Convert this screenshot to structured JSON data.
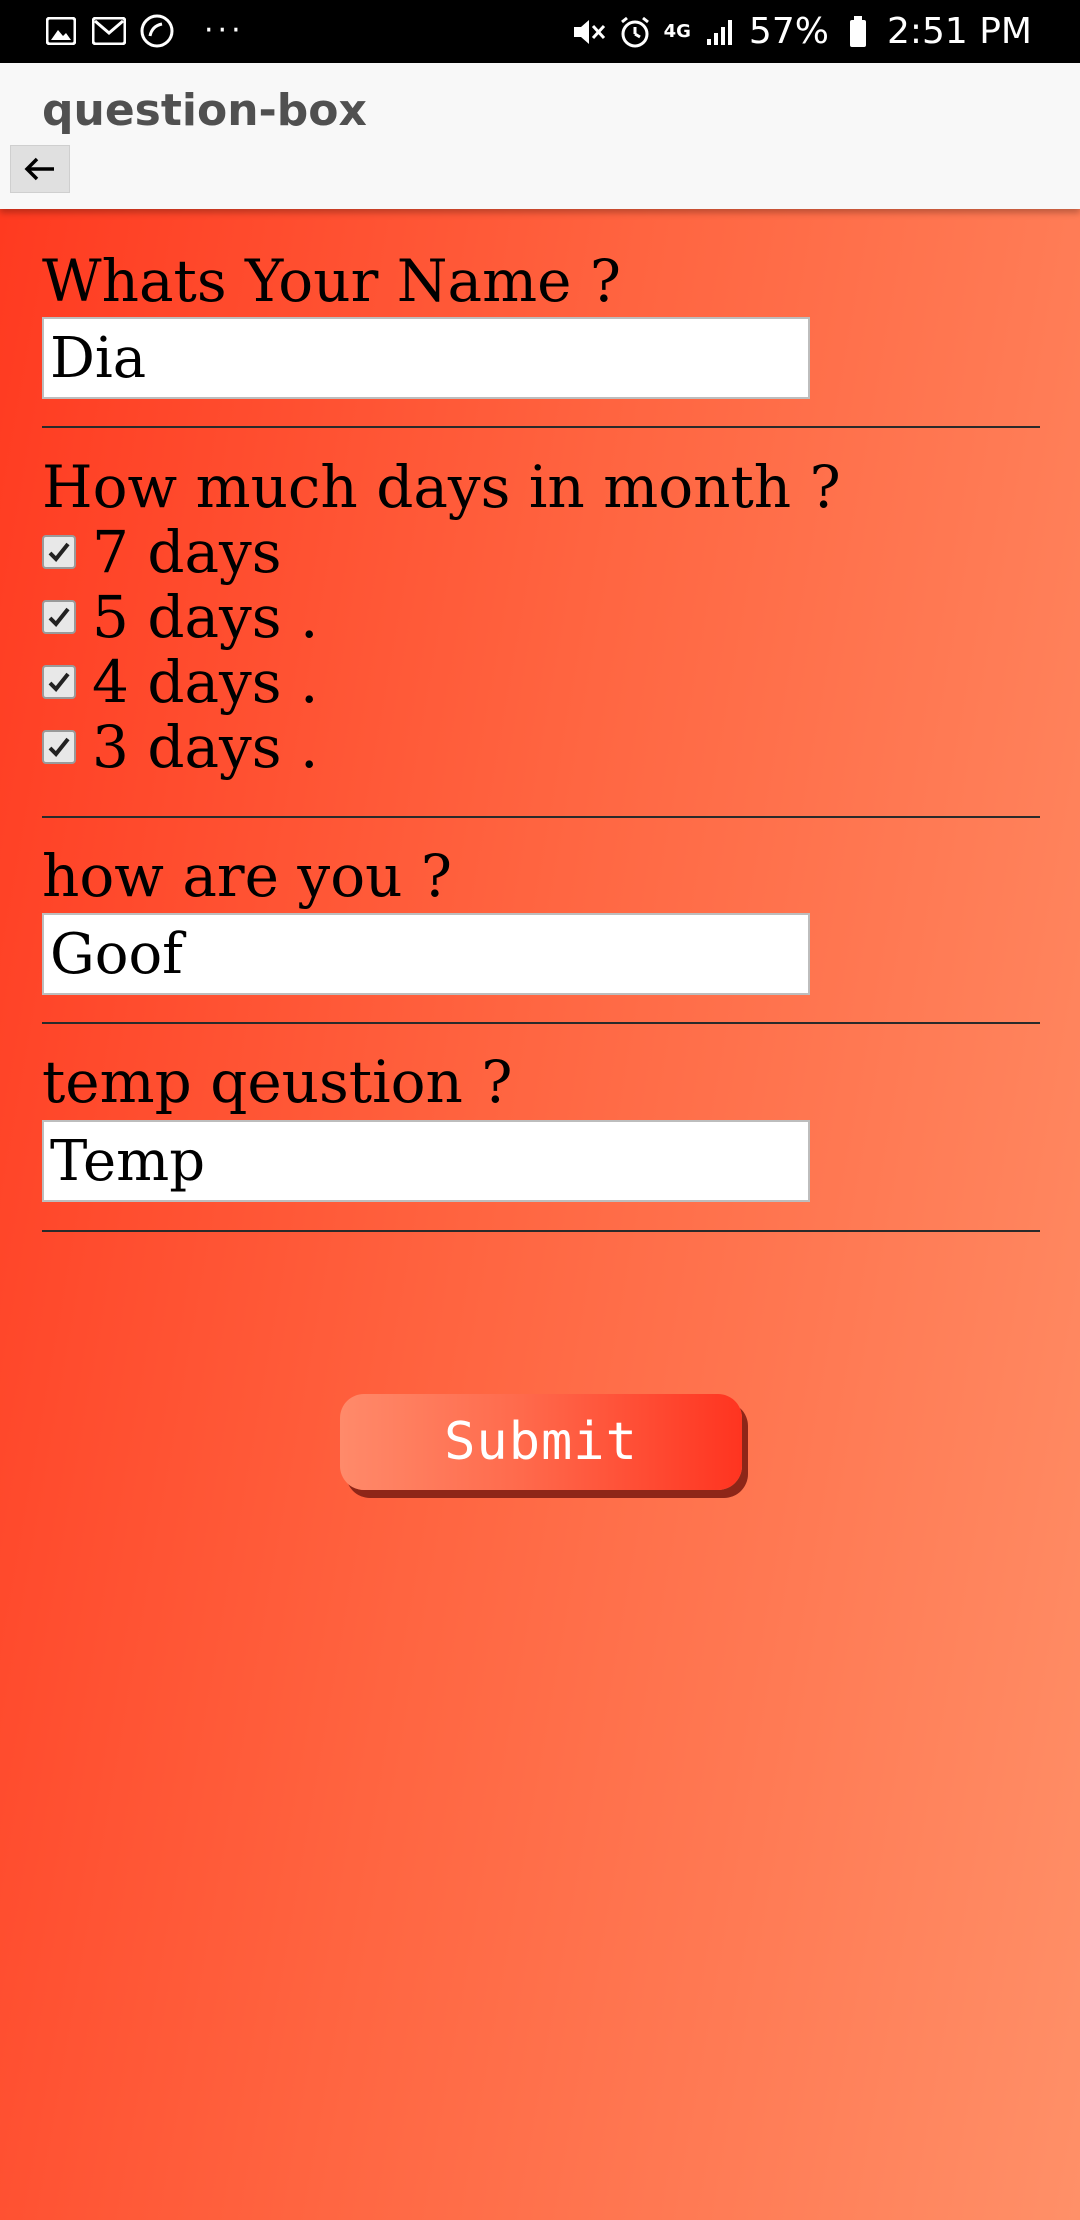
{
  "status_bar": {
    "left_icons": [
      "image-icon",
      "gmail-icon",
      "call-icon"
    ],
    "more": "···",
    "network": "4G",
    "battery": "57%",
    "time": "2:51 PM"
  },
  "app_bar": {
    "title": "question-box",
    "back_icon": "arrow-left-icon"
  },
  "questions": [
    {
      "type": "text",
      "label": "Whats Your Name ?",
      "value": "Dia"
    },
    {
      "type": "checkbox",
      "label": "How much days in month ?",
      "options": [
        {
          "label": "7 days",
          "checked": true
        },
        {
          "label": "5 days .",
          "checked": true
        },
        {
          "label": "4 days .",
          "checked": true
        },
        {
          "label": "3 days .",
          "checked": true
        }
      ]
    },
    {
      "type": "text",
      "label": "how are you ?",
      "value": "Goof"
    },
    {
      "type": "text",
      "label": "temp qeustion ?",
      "value": "Temp"
    }
  ],
  "submit": {
    "label": "Submit"
  },
  "colors": {
    "background_start": "#ff3a20",
    "background_end": "#ff9068",
    "button_shadow": "#8e2618"
  }
}
